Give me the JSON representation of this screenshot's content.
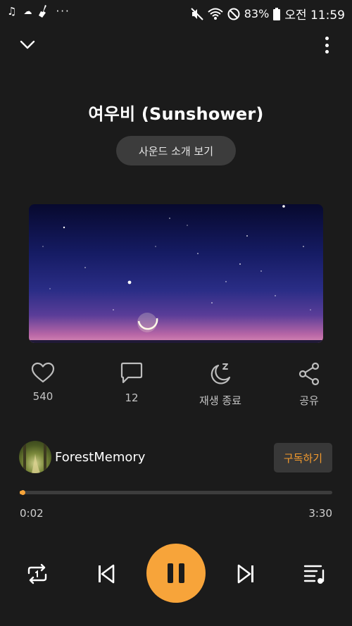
{
  "status_bar": {
    "battery": "83%",
    "time": "오전 11:59",
    "left_icons": [
      "music-note-icon",
      "cloud-icon",
      "broom-icon",
      "more-dots-icon"
    ],
    "right_icons": [
      "mute-icon",
      "wifi-icon",
      "do-not-disturb-icon",
      "battery-icon"
    ]
  },
  "header": {
    "collapse_icon": "chevron-down-icon",
    "more_icon": "more-vertical-icon"
  },
  "track": {
    "title": "여우비 (Sunshower)",
    "intro_label": "사운드 소개 보기"
  },
  "actions": {
    "like_count": "540",
    "comment_count": "12",
    "sleep_label": "재생 종료",
    "share_label": "공유"
  },
  "channel": {
    "name": "ForestMemory",
    "subscribe_label": "구독하기"
  },
  "progress": {
    "current": "0:02",
    "total": "3:30",
    "fraction": 0.01
  },
  "controls": {
    "icons": [
      "repeat-one-icon",
      "previous-icon",
      "pause-icon",
      "next-icon",
      "playlist-icon"
    ]
  },
  "colors": {
    "accent": "#f7a43a",
    "background": "#1b1b1b"
  }
}
